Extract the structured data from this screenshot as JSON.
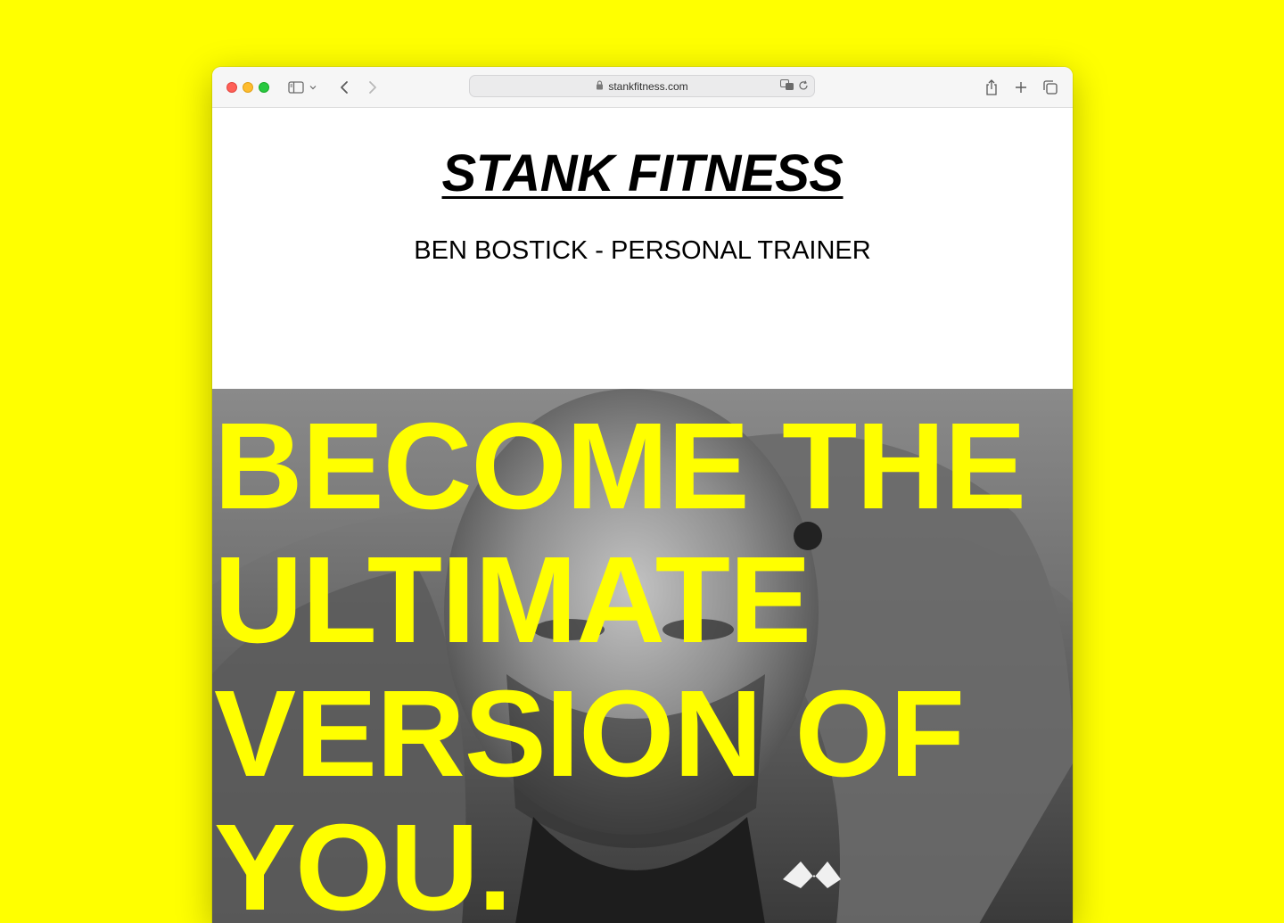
{
  "browser": {
    "url": "stankfitness.com"
  },
  "site": {
    "title": "STANK FITNESS",
    "tagline": "BEN BOSTICK - PERSONAL TRAINER"
  },
  "hero": {
    "headline_lines": [
      "BECOME THE",
      "ULTIMATE",
      "VERSION OF",
      "YOU."
    ],
    "photo_description_icon": "trainer-photo",
    "headline_color": "#ffff00"
  },
  "colors": {
    "page_background": "#ffff00",
    "accent": "#ffff00"
  }
}
